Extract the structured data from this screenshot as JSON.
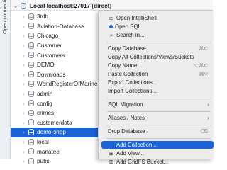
{
  "side_tab": {
    "label": "Open connections"
  },
  "connection": {
    "label": "Local localhost:27017 [direct]"
  },
  "databases": [
    {
      "label": "3tdb",
      "selected": false
    },
    {
      "label": "Aviation-Database",
      "selected": false
    },
    {
      "label": "Chicago",
      "selected": false
    },
    {
      "label": "Customer",
      "selected": false
    },
    {
      "label": "Customers",
      "selected": false
    },
    {
      "label": "DEMO",
      "selected": false
    },
    {
      "label": "Downloads",
      "selected": false
    },
    {
      "label": "WorldRegisterOfMarineSpe",
      "selected": false
    },
    {
      "label": "admin",
      "selected": false
    },
    {
      "label": "config",
      "selected": false
    },
    {
      "label": "crimes",
      "selected": false
    },
    {
      "label": "customerdata",
      "selected": false
    },
    {
      "label": "demo-shop",
      "selected": true
    },
    {
      "label": "local",
      "selected": false
    },
    {
      "label": "manatee",
      "selected": false
    },
    {
      "label": "pubs",
      "selected": false
    }
  ],
  "context_menu": {
    "open_intellishell": "Open IntelliShell",
    "open_sql": "Open SQL",
    "search_in": "Search in...",
    "copy_database": "Copy Database",
    "copy_database_shortcut": "⌘C",
    "copy_all": "Copy All Collections/Views/Buckets",
    "copy_name": "Copy Name",
    "copy_name_shortcut": "⌥⌘C",
    "paste_collection": "Paste Collection",
    "paste_collection_shortcut": "⌘V",
    "export_collections": "Export Collections...",
    "import_collections": "Import Collections...",
    "sql_migration": "SQL Migration",
    "aliases_notes": "Aliases / Notes",
    "drop_database": "Drop Database",
    "drop_database_shortcut": "⌫",
    "add_collection": "Add Collection...",
    "add_view": "Add View...",
    "add_gridfs_bucket": "Add GridFS Bucket..."
  },
  "colors": {
    "accent": "#1a62d6"
  }
}
